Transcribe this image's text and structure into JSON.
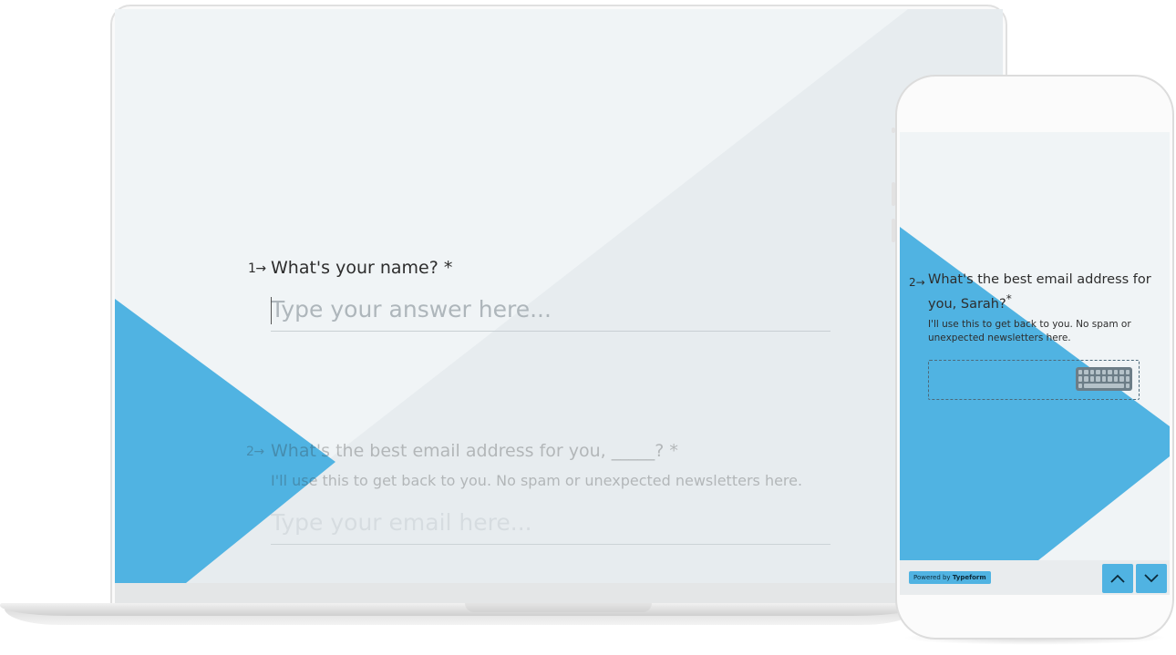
{
  "laptop": {
    "question1": {
      "number": "1",
      "title": "What's your name? *",
      "placeholder": "Type your answer here..."
    },
    "question2": {
      "number": "2",
      "title": "What's the best email address for you, _____? *",
      "description": "I'll use this to get back to you. No spam or unexpected newsletters here.",
      "placeholder": "Type your email here..."
    }
  },
  "phone": {
    "question": {
      "number": "2",
      "title": "What's the best email address for you, Sarah?",
      "required_mark": "*",
      "description": "I'll use this to get back to you. No spam or unexpected newsletters here."
    },
    "input_icon": "keyboard-icon",
    "footer": {
      "powered_prefix": "Powered by",
      "powered_brand": "Typeform",
      "up_icon": "chevron-up-icon",
      "down_icon": "chevron-down-icon"
    }
  },
  "colors": {
    "accent_blue": "#50b3e2",
    "screen_background": "#f0f4f6",
    "diagonal_shade": "#e7ecef",
    "text": "#2d2d2d"
  }
}
